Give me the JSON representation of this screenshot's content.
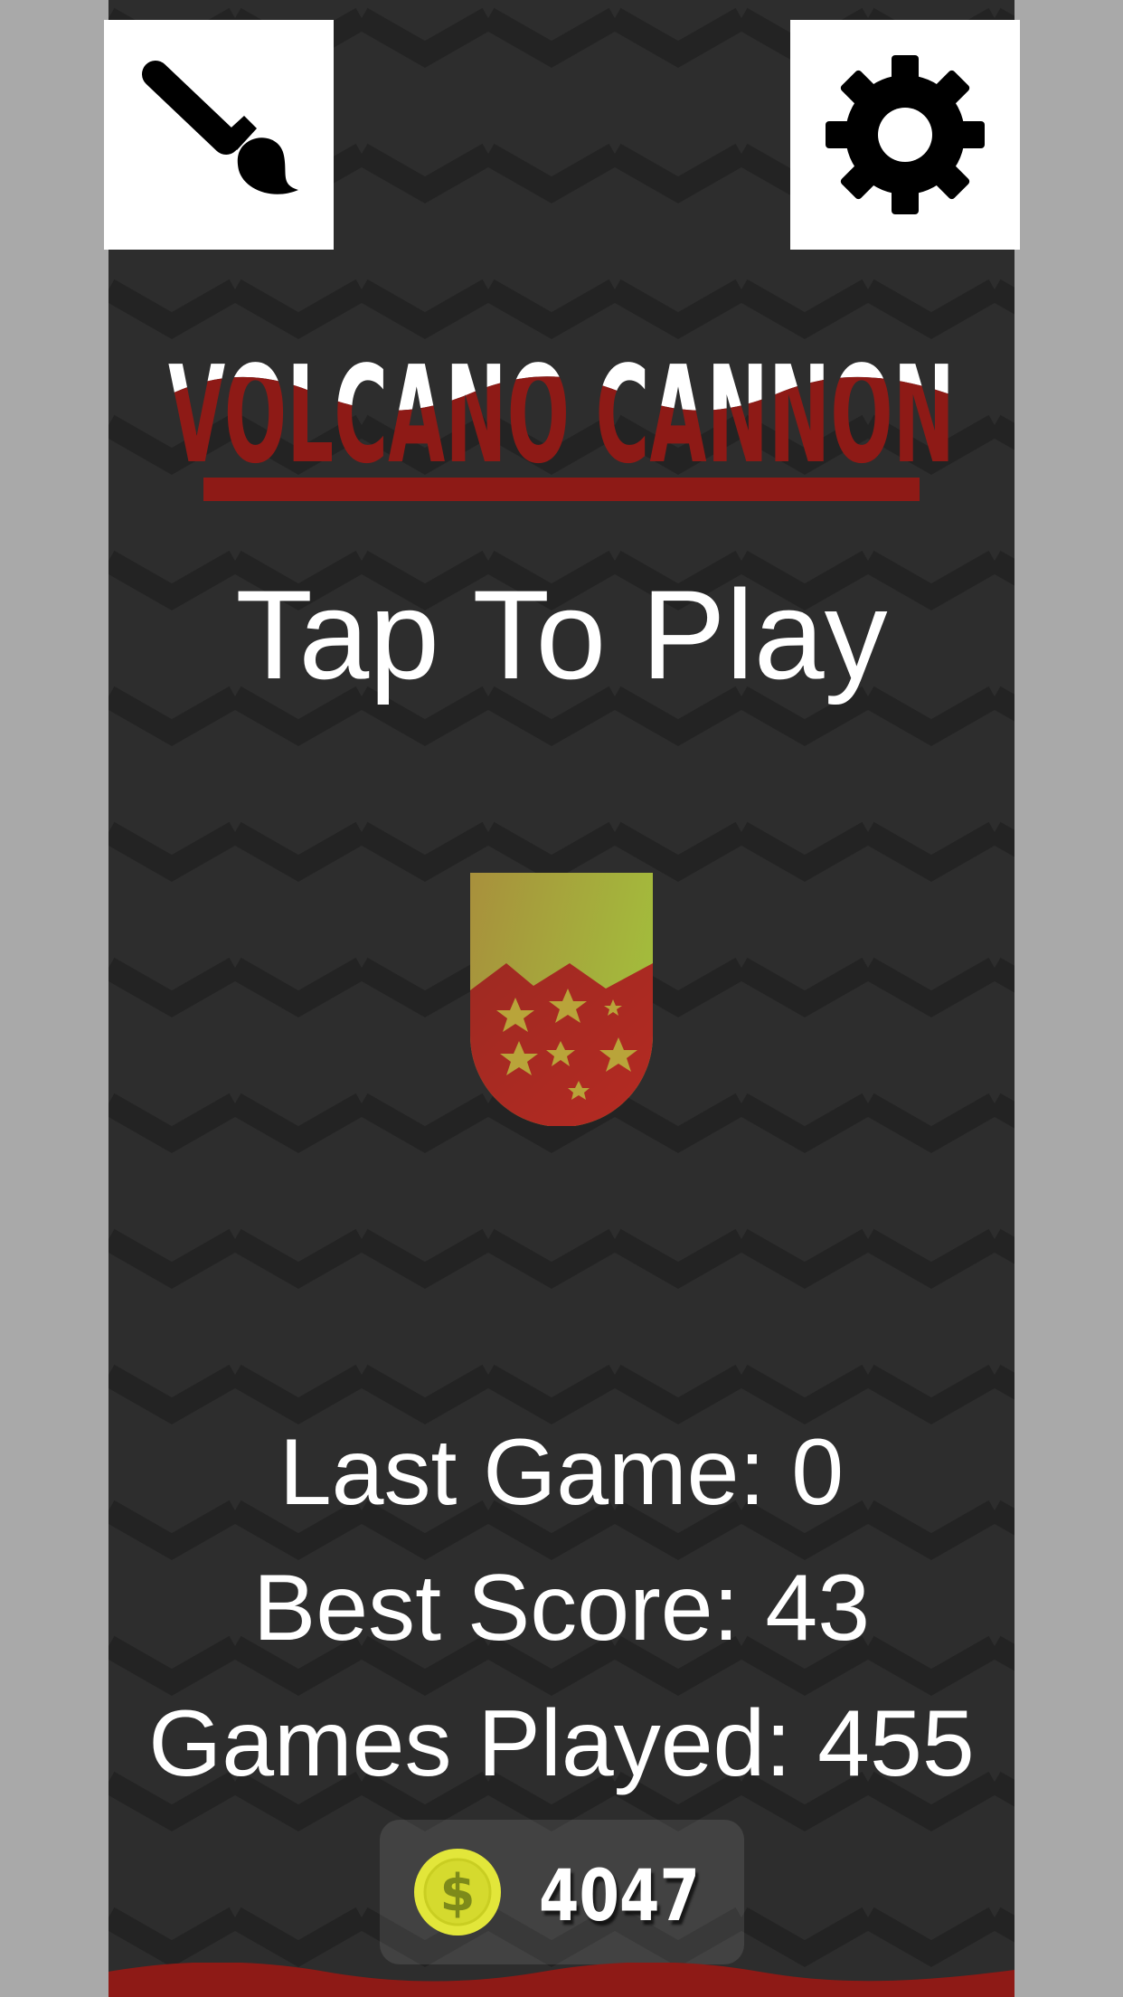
{
  "title": "VOLCANO CANNON",
  "tap_to_play": "Tap To Play",
  "stats": {
    "last_game": "Last Game: 0",
    "best_score": "Best Score: 43",
    "games_played": "Games Played: 455"
  },
  "coins": "4047",
  "icons": {
    "left_button": "paintbrush-icon",
    "right_button": "gear-icon",
    "coin": "dollar-coin-icon"
  },
  "colors": {
    "background": "#2d2d2d",
    "chevron": "#232323",
    "lava_red": "#8e1a16",
    "cannon_top": "#a3b33c",
    "cannon_bottom": "#b02a22",
    "star": "#b9a43a",
    "coin_yellow": "#e8ec3c"
  }
}
